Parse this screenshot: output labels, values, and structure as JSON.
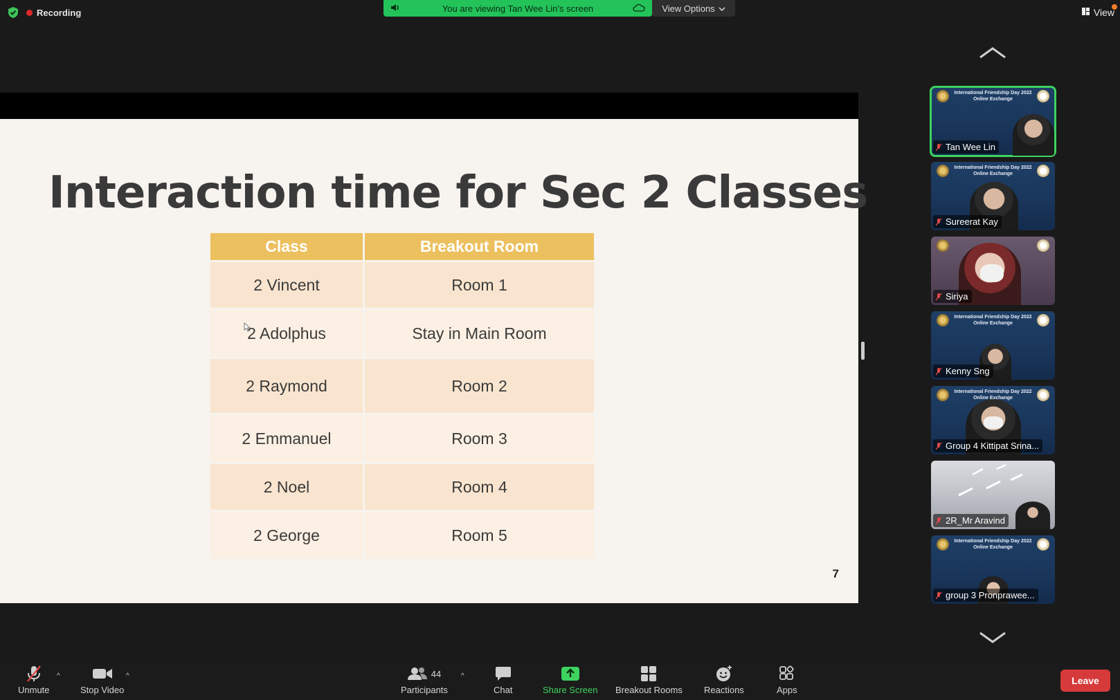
{
  "top": {
    "recording_label": "Recording",
    "viewing_text": "You are viewing Tan Wee Lin's screen",
    "view_options_label": "View Options",
    "view_label": "View"
  },
  "slide": {
    "title": "Interaction time for Sec 2 Classes",
    "page_number": "7",
    "table": {
      "headers": [
        "Class",
        "Breakout Room"
      ],
      "rows": [
        [
          "2 Vincent",
          "Room 1"
        ],
        [
          "2 Adolphus",
          "Stay in Main Room"
        ],
        [
          "2 Raymond",
          "Room 2"
        ],
        [
          "2 Emmanuel",
          "Room 3"
        ],
        [
          "2 Noel",
          "Room 4"
        ],
        [
          "2 George",
          "Room 5"
        ]
      ]
    }
  },
  "gallery": {
    "tile_banner": "International Friendship Day 2022 Online Exchange",
    "participants": [
      {
        "name": "Tan Wee Lin"
      },
      {
        "name": "Sureerat Kay"
      },
      {
        "name": "Siriya"
      },
      {
        "name": "Kenny Sng"
      },
      {
        "name": "Group 4 Kittipat Srina..."
      },
      {
        "name": "2R_Mr Aravind"
      },
      {
        "name": "group 3 Pronprawee..."
      }
    ]
  },
  "toolbar": {
    "unmute_label": "Unmute",
    "stop_video_label": "Stop Video",
    "participants_label": "Participants",
    "participants_count": "44",
    "chat_label": "Chat",
    "share_screen_label": "Share Screen",
    "breakout_rooms_label": "Breakout Rooms",
    "reactions_label": "Reactions",
    "apps_label": "Apps",
    "leave_label": "Leave"
  },
  "colors": {
    "banner_green": "#23c35a",
    "table_header": "#ecc05e",
    "row_dark": "#f9e5cf",
    "row_light": "#fbf0e3",
    "leave_red": "#d63a3a",
    "active_speaker": "#3ed35f"
  }
}
